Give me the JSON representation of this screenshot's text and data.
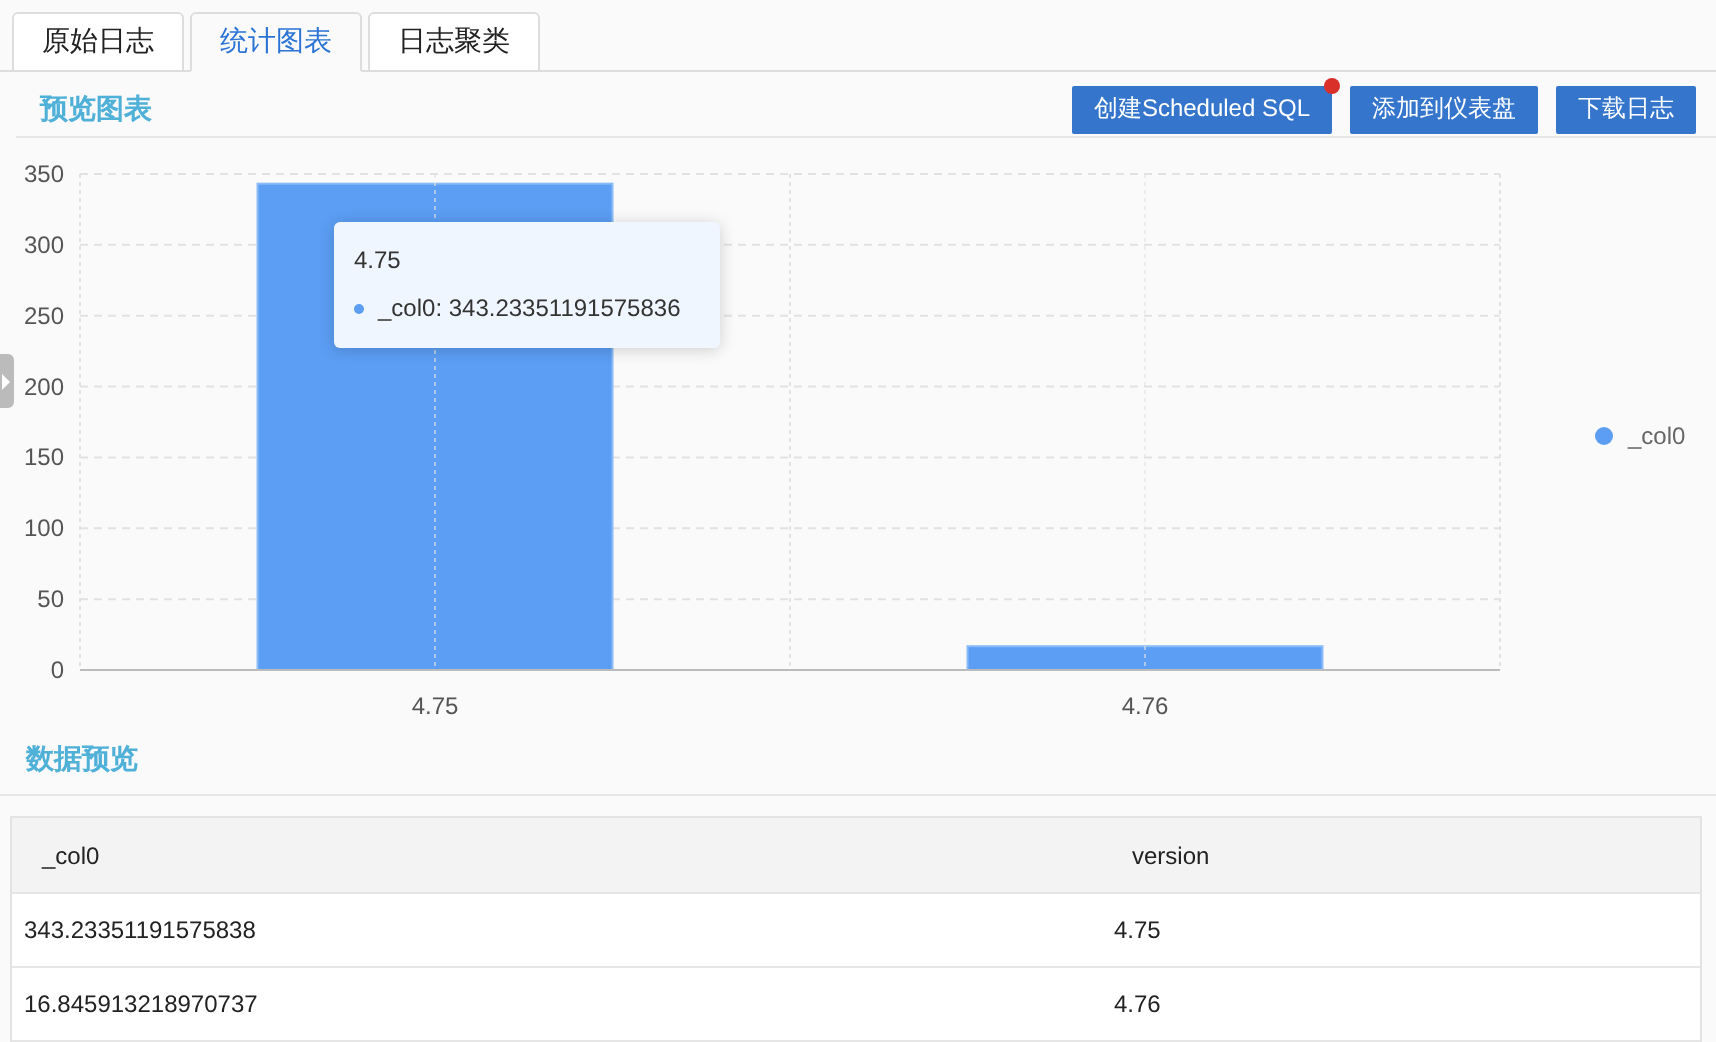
{
  "tabs": [
    {
      "label": "原始日志",
      "selected": false
    },
    {
      "label": "统计图表",
      "selected": true
    },
    {
      "label": "日志聚类",
      "selected": false
    }
  ],
  "chart_section": {
    "title": "预览图表"
  },
  "actions": [
    {
      "label": "创建Scheduled SQL",
      "badge": true
    },
    {
      "label": "添加到仪表盘",
      "badge": false
    },
    {
      "label": "下载日志",
      "badge": false
    }
  ],
  "chart_data": {
    "type": "bar",
    "categories": [
      "4.75",
      "4.76"
    ],
    "series": [
      {
        "name": "_col0",
        "color": "#5b9ef4",
        "values": [
          343.2,
          16.8
        ]
      }
    ],
    "grid": true,
    "ylim": [
      0,
      350
    ],
    "yticks": [
      0,
      50,
      100,
      150,
      200,
      250,
      300,
      350
    ]
  },
  "tooltip": {
    "title": "4.75",
    "text": "_col0: 343.23351191575836"
  },
  "table_section": {
    "title": "数据预览"
  },
  "table": {
    "columns": [
      "_col0",
      "version"
    ],
    "rows": [
      [
        "343.23351191575838",
        "4.75"
      ],
      [
        "16.845913218970737",
        "4.76"
      ]
    ]
  }
}
